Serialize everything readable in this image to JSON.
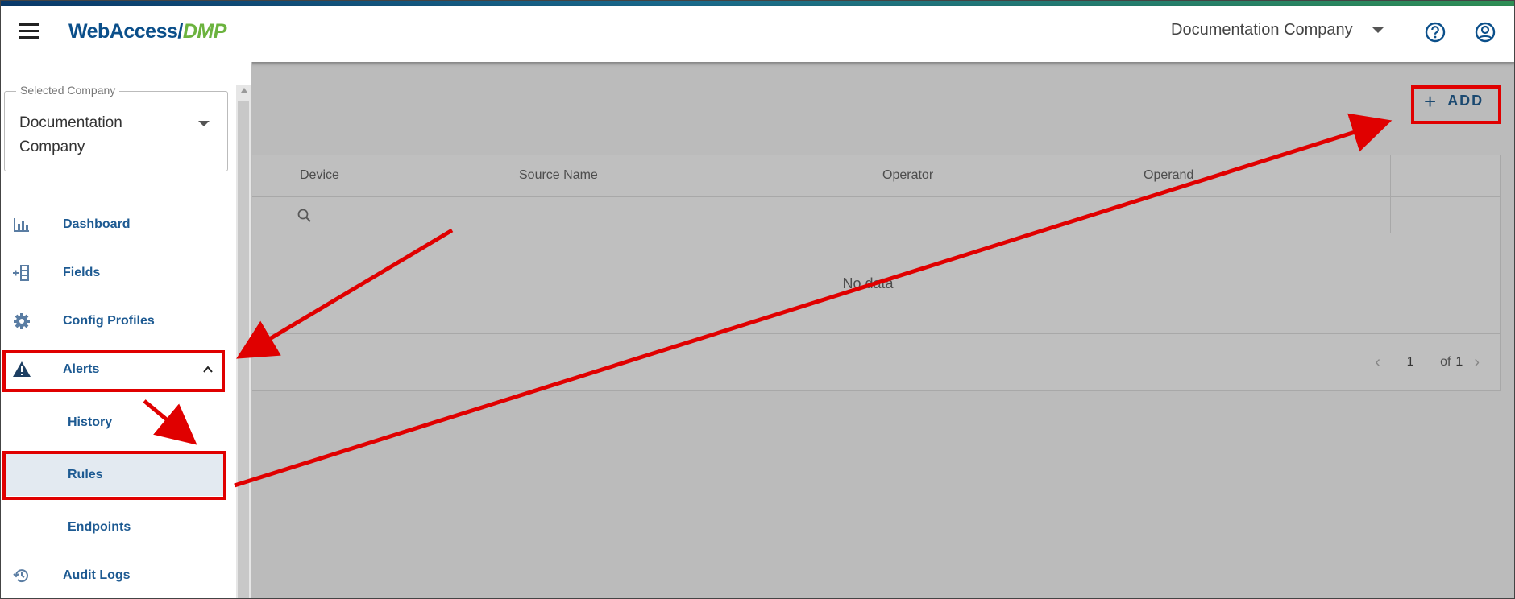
{
  "header": {
    "logo_part1": "WebAccess/",
    "logo_part2": "DMP",
    "company": "Documentation Company"
  },
  "drawer": {
    "company_field_label": "Selected Company",
    "company_field_value": "Documentation Company",
    "items": [
      {
        "label": "Dashboard",
        "icon": "bar-chart-icon"
      },
      {
        "label": "Fields",
        "icon": "add-field-icon"
      },
      {
        "label": "Config Profiles",
        "icon": "gear-icon"
      },
      {
        "label": "Alerts",
        "icon": "warning-icon",
        "expanded": true
      },
      {
        "label": "History"
      },
      {
        "label": "Rules",
        "active": true
      },
      {
        "label": "Endpoints"
      },
      {
        "label": "Audit Logs",
        "icon": "history-icon"
      }
    ]
  },
  "main": {
    "add_label": "ADD",
    "table": {
      "columns": [
        "Device",
        "Source Name",
        "Operator",
        "Operand"
      ],
      "empty_text": "No data"
    },
    "pager": {
      "current_page": "1",
      "of_label": "of",
      "total_pages": "1"
    }
  },
  "annotation_color": "#e00000"
}
